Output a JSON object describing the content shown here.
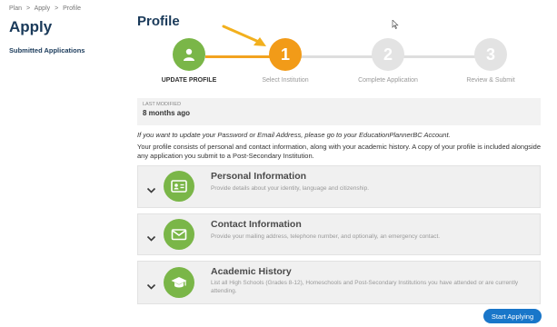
{
  "breadcrumb": [
    "Plan",
    ">",
    "Apply",
    ">",
    "Profile"
  ],
  "sidebar": {
    "title": "Apply",
    "link": "Submitted Applications"
  },
  "page": {
    "title": "Profile"
  },
  "steps": [
    {
      "number": "",
      "label": "UPDATE PROFILE",
      "state": "complete",
      "color": "#7ab648"
    },
    {
      "number": "1",
      "label": "Select Institution",
      "state": "current",
      "color": "#f29b18"
    },
    {
      "number": "2",
      "label": "Complete Application",
      "state": "pending",
      "color": "#e3e3e3"
    },
    {
      "number": "3",
      "label": "Review & Submit",
      "state": "pending",
      "color": "#e3e3e3"
    }
  ],
  "meta": {
    "label": "LAST MODIFIED",
    "value": "8 months ago"
  },
  "notes": {
    "italic": "If you want to update your Password or Email Address, please go to your EducationPlannerBC Account.",
    "body": "Your profile consists of personal and contact information, along with your academic history. A copy of your profile is included alongside any application you submit to a Post-Secondary Institution."
  },
  "sections": [
    {
      "title": "Personal Information",
      "description": "Provide details about your identity, language and citizenship.",
      "icon": "id-card-icon"
    },
    {
      "title": "Contact Information",
      "description": "Provide your mailing address, telephone number, and optionally, an emergency contact.",
      "icon": "envelope-icon"
    },
    {
      "title": "Academic History",
      "description": "List all High Schools (Grades 8-12), Homeschools and Post-Secondary Institutions you have attended or are currently attending.",
      "icon": "graduation-cap-icon"
    }
  ],
  "actions": {
    "start": "Start Applying"
  },
  "colors": {
    "accent": "#7ab648",
    "current": "#f29b18",
    "button": "#1976c9",
    "heading": "#1a3a5a"
  }
}
